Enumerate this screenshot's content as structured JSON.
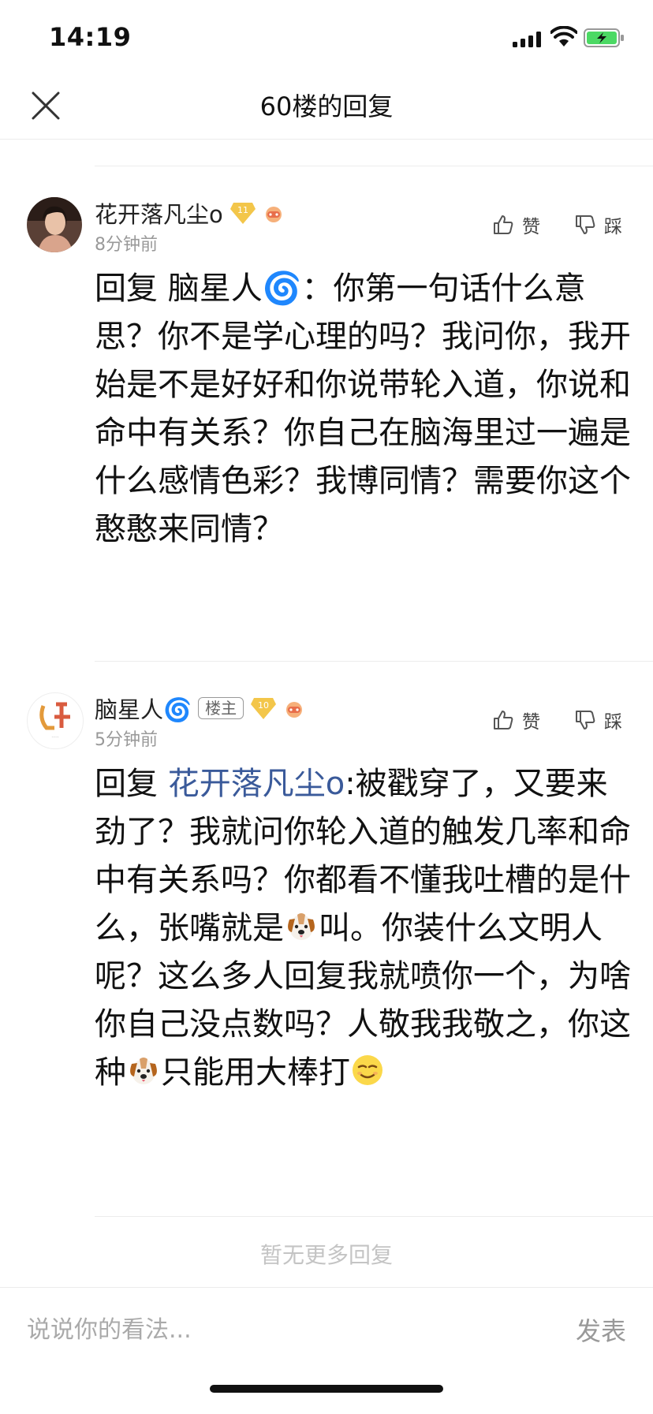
{
  "status_bar": {
    "time": "14:19"
  },
  "nav": {
    "title": "60楼的回复"
  },
  "comments": [
    {
      "username": "花开落凡尘o",
      "level": "11",
      "time": "8分钟前",
      "like_label": "赞",
      "dislike_label": "踩",
      "reply_prefix": "回复",
      "mention": "脑星人",
      "mention_emoji": "🌀",
      "separator": "：",
      "body": "你第一句话什么意思？你不是学心理的吗？我问你，我开始是不是好好和你说带轮入道，你说和命中有关系？你自己在脑海里过一遍是什么感情色彩？我博同情？需要你这个憨憨来同情？"
    },
    {
      "username": "脑星人",
      "username_emoji": "🌀",
      "owner_badge": "楼主",
      "level": "10",
      "time": "5分钟前",
      "like_label": "赞",
      "dislike_label": "踩",
      "reply_prefix": "回复",
      "mention": "花开落凡尘o",
      "body_part1": ":被戳穿了，又要来劲了？我就问你轮入道的触发几率和命中有关系吗？你都看不懂我吐槽的是什么，张嘴就是",
      "body_part2": "叫。你装什么文明人呢？这么多人回复我就喷你一个，为啥你自己没点数吗？人敬我我敬之，你这种",
      "body_part3": "只能用大棒打"
    }
  ],
  "footer": {
    "no_more": "暂无更多回复",
    "input_placeholder": "说说你的看法...",
    "send_label": "发表"
  },
  "colors": {
    "mention": "#3a5a9a",
    "muted": "#999999",
    "divider": "#ececec"
  }
}
